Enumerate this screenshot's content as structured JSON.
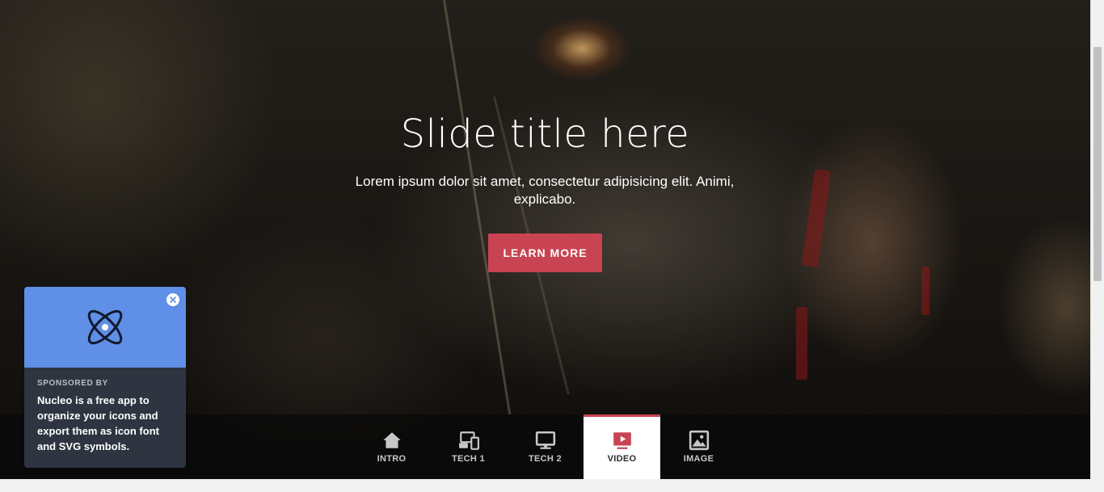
{
  "hero": {
    "title": "Slide title here",
    "text": "Lorem ipsum dolor sit amet, consectetur adipisicing elit. Animi, explicabo.",
    "button_label": "LEARN MORE"
  },
  "nav": {
    "items": [
      {
        "label": "INTRO",
        "icon": "home-icon"
      },
      {
        "label": "TECH 1",
        "icon": "devices-icon"
      },
      {
        "label": "TECH 2",
        "icon": "monitor-icon"
      },
      {
        "label": "VIDEO",
        "icon": "video-icon",
        "active": true
      },
      {
        "label": "IMAGE",
        "icon": "image-icon"
      }
    ]
  },
  "sponsor": {
    "kicker": "SPONSORED BY",
    "description": "Nucleo is a free app to organize your icons and export them as icon font and SVG symbols.",
    "logo_icon": "atom-icon",
    "close_icon": "close-icon"
  },
  "colors": {
    "accent": "#c94452",
    "sponsor_top": "#5f8fe6",
    "sponsor_body": "#2e3440",
    "nav_bg": "#0a0a0a"
  }
}
